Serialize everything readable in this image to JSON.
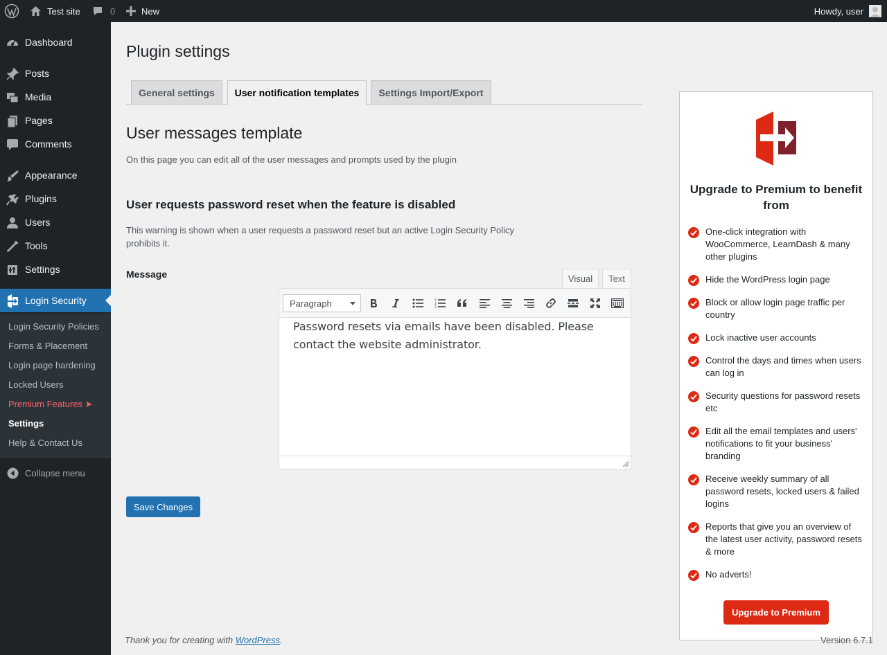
{
  "adminbar": {
    "site_name": "Test site",
    "comments_count": "0",
    "new_label": "New",
    "howdy": "Howdy, user"
  },
  "sidebar": {
    "items": [
      {
        "label": "Dashboard",
        "icon": "dashboard-icon"
      },
      {
        "label": "Posts",
        "icon": "pin-icon"
      },
      {
        "label": "Media",
        "icon": "media-icon"
      },
      {
        "label": "Pages",
        "icon": "pages-icon"
      },
      {
        "label": "Comments",
        "icon": "comment-icon"
      },
      {
        "label": "Appearance",
        "icon": "brush-icon"
      },
      {
        "label": "Plugins",
        "icon": "plug-icon"
      },
      {
        "label": "Users",
        "icon": "user-icon"
      },
      {
        "label": "Tools",
        "icon": "wrench-icon"
      },
      {
        "label": "Settings",
        "icon": "settings-icon"
      },
      {
        "label": "Login Security",
        "icon": "login-security-icon"
      }
    ],
    "submenu": [
      "Login Security Policies",
      "Forms & Placement",
      "Login page hardening",
      "Locked Users",
      "Premium Features ➤",
      "Settings",
      "Help & Contact Us"
    ],
    "collapse_label": "Collapse menu"
  },
  "main": {
    "page_title": "Plugin settings",
    "tabs": [
      {
        "label": "General settings"
      },
      {
        "label": "User notification templates"
      },
      {
        "label": "Settings Import/Export"
      }
    ],
    "section_title": "User messages template",
    "section_desc": "On this page you can edit all of the user messages and prompts used by the plugin",
    "subsection_title": "User requests password reset when the feature is disabled",
    "subsection_desc": "This warning is shown when a user requests a password reset but an active Login Security Policy prohibits it.",
    "message_label": "Message",
    "editor": {
      "tab_visual": "Visual",
      "tab_text": "Text",
      "format_value": "Paragraph",
      "content": "Password resets via emails have been disabled. Please contact the website administrator."
    },
    "save_label": "Save Changes"
  },
  "premium": {
    "title": "Upgrade to Premium to benefit from",
    "features": [
      "One-click integration with WooCommerce, LearnDash & many other plugins",
      "Hide the WordPress login page",
      "Block or allow login page traffic per country",
      "Lock inactive user accounts",
      "Control the days and times when users can log in",
      "Security questions for password resets etc",
      "Edit all the email templates and users' notifications to fit your business' branding",
      "Receive weekly summary of all password resets, locked users & failed logins",
      "Reports that give you an overview of the latest user activity, password resets & more",
      "No adverts!"
    ],
    "button_label": "Upgrade to Premium"
  },
  "footer": {
    "thanks_prefix": "Thank you for creating with ",
    "thanks_link": "WordPress",
    "thanks_suffix": ".",
    "version": "Version 6.7.1"
  },
  "colors": {
    "admin_dark": "#1d2327",
    "accent_blue": "#2271b1",
    "premium_red": "#dd2a15"
  }
}
